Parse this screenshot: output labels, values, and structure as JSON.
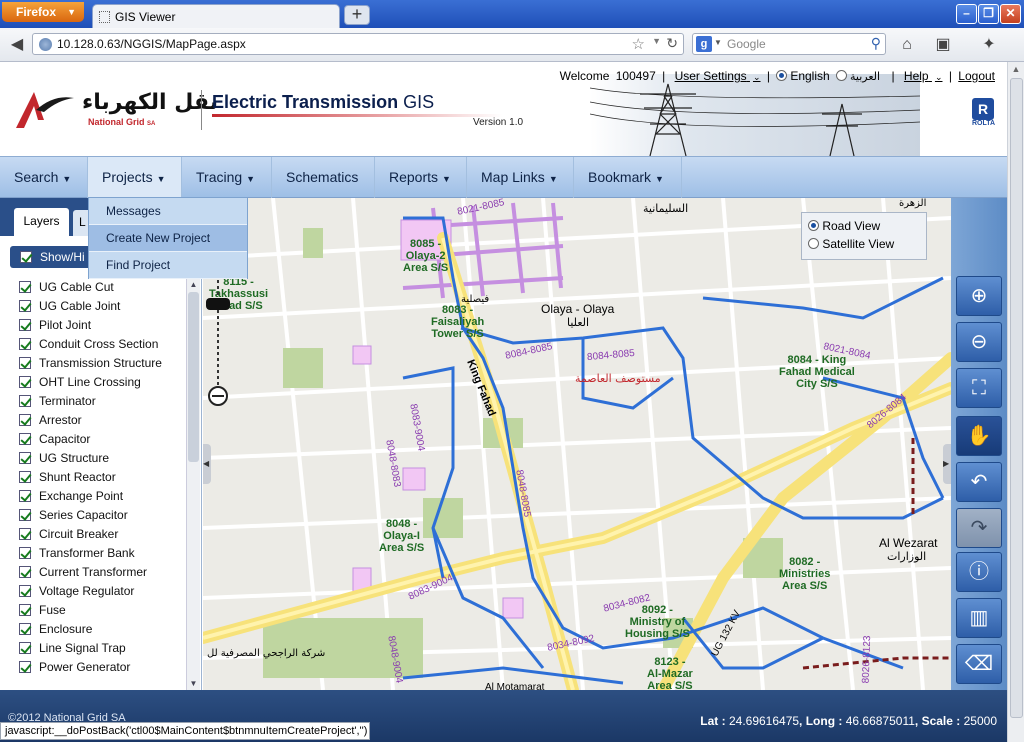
{
  "browser": {
    "app_button": "Firefox",
    "tab_title": "GIS Viewer",
    "new_tab": "+",
    "url": "10.128.0.63/NGGIS/MapPage.aspx",
    "search_placeholder": "Google",
    "icons": [
      "back-icon",
      "globe-icon",
      "bookmark-star-icon",
      "reload-icon",
      "google-icon",
      "search-icon",
      "home-icon",
      "bookmarks-icon",
      "addon-icon"
    ]
  },
  "header": {
    "logo_arabic": "نقل الكهرباء",
    "logo_english": "National Grid",
    "logo_sa": "SA",
    "app_title_main": "Electric Transmission",
    "app_title_suffix": "GIS",
    "version": "Version 1.0",
    "welcome": "Welcome",
    "user_id": "100497",
    "user_settings": "User Settings",
    "lang_english": "English",
    "lang_arabic": "العربية",
    "help": "Help",
    "logout": "Logout",
    "sep": "|",
    "rolta": "ROLTA",
    "rolta_mark": "R"
  },
  "menu": {
    "items": [
      "Search",
      "Projects",
      "Tracing",
      "Schematics",
      "Reports",
      "Map Links",
      "Bookmark"
    ],
    "projects_dropdown": [
      "Messages",
      "Create New Project",
      "Find Project"
    ],
    "active_dropdown_item": "Create New Project"
  },
  "leftpanel": {
    "tab_layers": "Layers",
    "tab_other": "L",
    "show_hide": "Show/Hi",
    "layers": [
      "UG Cable Cut",
      "UG Cable Joint",
      "Pilot Joint",
      "Conduit Cross Section",
      "Transmission Structure",
      "OHT Line Crossing",
      "Terminator",
      "Arrestor",
      "Capacitor",
      "UG Structure",
      "Shunt Reactor",
      "Exchange Point",
      "Series Capacitor",
      "Circuit Breaker",
      "Transformer Bank",
      "Current Transformer",
      "Voltage Regulator",
      "Fuse",
      "Enclosure",
      "Line Signal Trap",
      "Power Generator"
    ]
  },
  "map": {
    "view_options": [
      "Road View",
      "Satellite View"
    ],
    "selected_view": "Road View",
    "labels": {
      "station_8085": "8085 -",
      "station_8085_b": "Olaya-2",
      "station_8085_c": "Area S/S",
      "station_8115": "8115 -",
      "station_8115_b": "Takhassusi",
      "station_8115_c": "Road S/S",
      "station_8083": "8083 -",
      "station_8083_b": "Faisaliyah",
      "station_8083_c": "Tower S/S",
      "olaya": "Olaya - Olaya",
      "olaya_ar": "العليا",
      "sulaimaniah_ar": "السليمانية",
      "station_8084": "8084 - King",
      "station_8084_b": "Fahad Medical",
      "station_8084_c": "City S/S",
      "line_8021_8085": "8021-8085",
      "line_8021_8084": "8021-8084",
      "line_8026_8084": "8026-8084",
      "line_8084_8085": "8084-8085",
      "line_8084_8085_b": "8084-8085",
      "line_8083_9004": "8083-9004",
      "line_8048_8083": "8048-8083",
      "line_8048_8085": "8048-8085",
      "line_8048_9004": "8048-9004",
      "line_8083_9004_b": "8083-9004",
      "line_8034_8082": "8034-8082",
      "line_8034_8092": "8034-8092",
      "line_8026_8123": "8026-8123",
      "hospital_ar": "مستوصف العاصمة",
      "king_fahad": "King Fahad",
      "station_8048": "8048 -",
      "station_8048_b": "Olaya-I",
      "station_8048_c": "Area S/S",
      "station_8092": "8092 -",
      "station_8092_b": "Ministry of",
      "station_8092_c": "Housing S/S",
      "station_8123": "8123 -",
      "station_8123_b": "Al-Mazar",
      "station_8123_c": "Area S/S",
      "station_8082": "8082 -",
      "station_8082_b": "Ministries",
      "station_8082_c": "Area S/S",
      "al_wezarat": "Al Wezarat",
      "wezarat_ar": "الوزارات",
      "ug_kv": "UG 132 KV",
      "rajhi_ar": "شركة الراجحي المصرفية لل",
      "al_mutamarat": "Al Motamarat",
      "faisaliah_ar": "فيصلية",
      "top_right_ar": "الزهرة"
    }
  },
  "toolbar": {
    "tools": [
      "zoom-in-icon",
      "zoom-out-icon",
      "full-extent-icon",
      "pan-hand-icon",
      "undo-icon",
      "redo-icon",
      "info-icon",
      "measure-icon",
      "eraser-icon",
      "print-icon"
    ]
  },
  "footer": {
    "copyright": "©2012 National Grid SA",
    "lat_label": "Lat :",
    "lat": "24.69616475",
    "long_label": "Long :",
    "long": "46.66875011",
    "scale_label": "Scale :",
    "scale": "25000",
    "status": "javascript:__doPostBack('ctl00$MainContent$btnmnuItemCreateProject','')"
  },
  "colors": {
    "brand_red": "#c2272d",
    "menu_blue": "#9ebfe6",
    "footer_blue": "#1b3866",
    "cable_blue": "#2e6fd6",
    "road_yellow": "#f7e27a"
  }
}
